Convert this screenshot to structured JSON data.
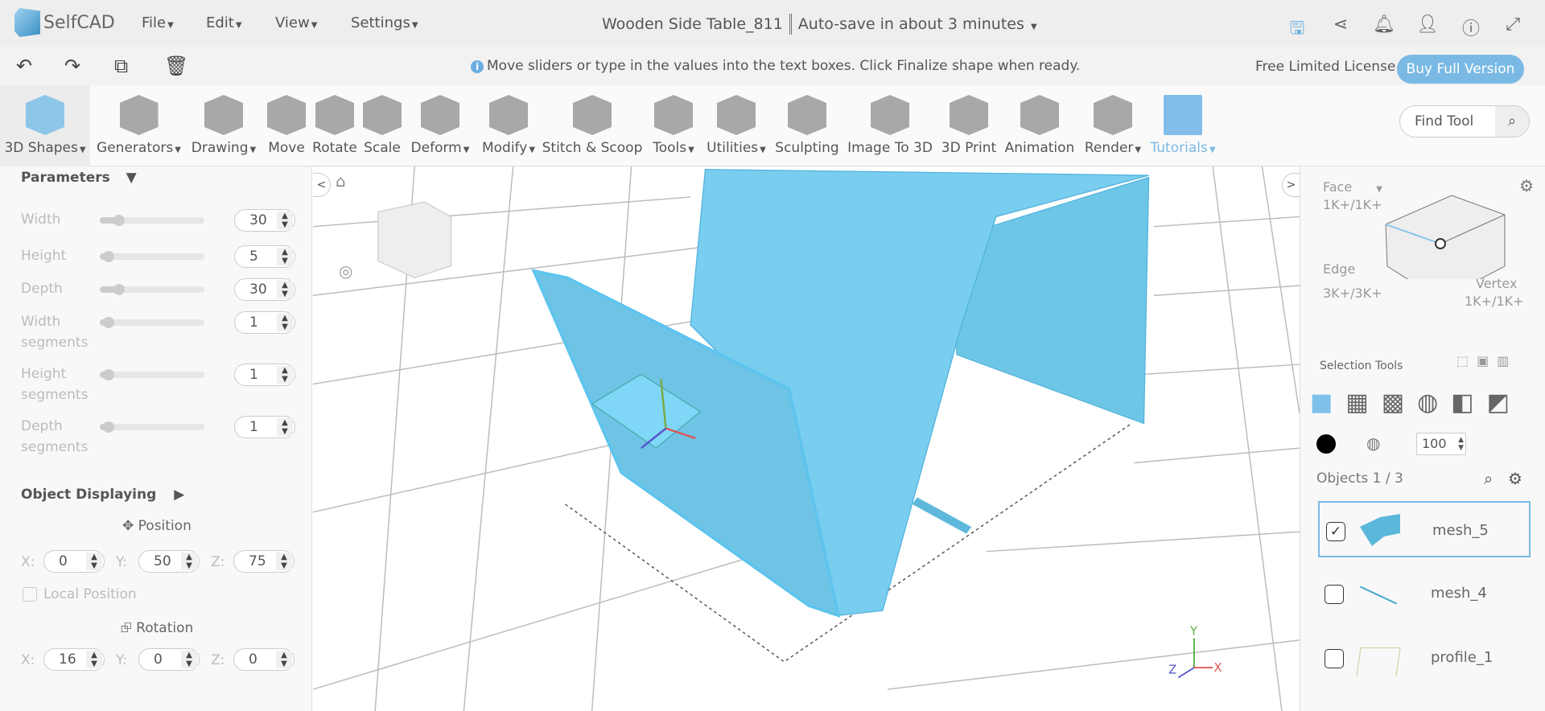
{
  "app": {
    "name": "SelfCAD"
  },
  "menu": [
    "File",
    "Edit",
    "View",
    "Settings"
  ],
  "title": {
    "file_name": "Wooden Side Table_811",
    "autosave": "Auto-save in about 3 minutes"
  },
  "header_icons": [
    "save-icon",
    "share-icon",
    "bell-icon",
    "user-icon",
    "info-icon",
    "fullscreen-icon"
  ],
  "hint": "Move sliders or type in the values into the text boxes. Click Finalize shape when ready.",
  "license": "Free Limited License",
  "buy_label": "Buy Full Version",
  "tools": [
    {
      "label": "3D Shapes",
      "dropdown": true
    },
    {
      "label": "Generators",
      "dropdown": true
    },
    {
      "label": "Drawing",
      "dropdown": true
    },
    {
      "label": "Move"
    },
    {
      "label": "Rotate"
    },
    {
      "label": "Scale"
    },
    {
      "label": "Deform",
      "dropdown": true
    },
    {
      "label": "Modify",
      "dropdown": true
    },
    {
      "label": "Stitch & Scoop"
    },
    {
      "label": "Tools",
      "dropdown": true
    },
    {
      "label": "Utilities",
      "dropdown": true
    },
    {
      "label": "Sculpting"
    },
    {
      "label": "Image To 3D"
    },
    {
      "label": "3D Print"
    },
    {
      "label": "Animation"
    },
    {
      "label": "Render",
      "dropdown": true
    },
    {
      "label": "Tutorials",
      "dropdown": true
    }
  ],
  "find_tool": "Find Tool",
  "params": {
    "title": "Parameters",
    "rows": [
      {
        "label": "Width",
        "value": "30",
        "slider": 0.1
      },
      {
        "label": "Height",
        "value": "5",
        "slider": 0
      },
      {
        "label": "Depth",
        "value": "30",
        "slider": 0.1
      },
      {
        "label": "Width segments",
        "value": "1",
        "slider": 0
      },
      {
        "label": "Height segments",
        "value": "1",
        "slider": 0
      },
      {
        "label": "Depth segments",
        "value": "1",
        "slider": 0
      }
    ]
  },
  "display": {
    "title": "Object Displaying",
    "position_label": "Position",
    "position": {
      "X": "0",
      "Y": "50",
      "Z": "75"
    },
    "local_position": "Local Position",
    "rotation_label": "Rotation",
    "rotation": {
      "X": "16",
      "Y": "0",
      "Z": "0"
    }
  },
  "selection": {
    "face": "Face",
    "face_count": "1K+/1K+",
    "edge": "Edge",
    "edge_count": "3K+/3K+",
    "vertex": "Vertex",
    "vertex_count": "1K+/1K+",
    "tools_label": "Selection Tools",
    "opacity": "100"
  },
  "objects": {
    "title": "Objects 1 / 3",
    "items": [
      {
        "name": "mesh_5",
        "checked": true
      },
      {
        "name": "mesh_4",
        "checked": false
      },
      {
        "name": "profile_1",
        "checked": false
      }
    ]
  },
  "axes": {
    "x": "X",
    "y": "Y",
    "z": "Z"
  },
  "colors": {
    "accent": "#7ab9e4",
    "mesh": "#6fcdf0"
  }
}
